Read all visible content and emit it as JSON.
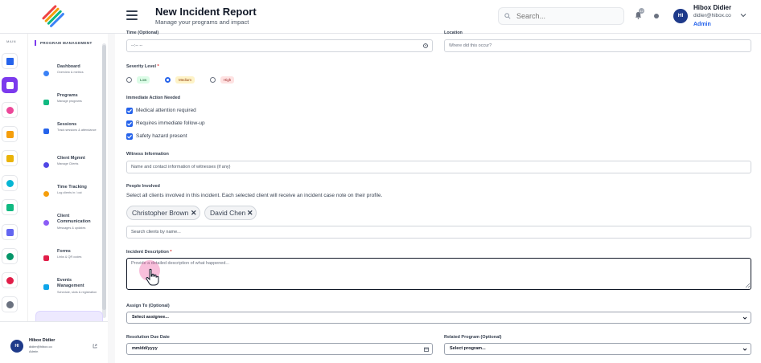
{
  "header": {
    "title": "New Incident Report",
    "subtitle": "Manage your programs and impact",
    "search_placeholder": "Search...",
    "notification_count": "12",
    "user": {
      "initials": "HI",
      "name": "Hibox Didier",
      "email": "didier@hibox.co",
      "role": "Admin"
    }
  },
  "rail": {
    "label": "MAIN"
  },
  "sidebar": {
    "section_title": "PROGRAM MANAGEMENT",
    "items": [
      {
        "label": "Dashboard",
        "desc": "Overview & metrics",
        "icon": "dashboard-icon"
      },
      {
        "label": "Programs",
        "desc": "Manage programs",
        "icon": "programs-icon"
      },
      {
        "label": "Sessions",
        "desc": "Track sessions & attendance",
        "icon": "sessions-icon"
      },
      {
        "label": "Client Mgmnt",
        "desc": "Manage Clients",
        "icon": "clients-icon"
      },
      {
        "label": "Time Tracking",
        "desc": "Log clients in / out",
        "icon": "time-icon"
      },
      {
        "label": "Client Communication",
        "desc": "Messages & updates",
        "icon": "communication-icon"
      },
      {
        "label": "Forms",
        "desc": "Links & QR codes",
        "icon": "forms-icon"
      },
      {
        "label": "Events Management",
        "desc": "Schedule, slots & registration",
        "icon": "events-icon"
      }
    ],
    "user": {
      "initials": "HI",
      "name": "Hibox Didier",
      "email": "didier@hibox.co",
      "role": "Admin"
    }
  },
  "form": {
    "time": {
      "label": "Time (Optional)",
      "value": "--:-- --"
    },
    "location": {
      "label": "Location",
      "placeholder": "Where did this occur?"
    },
    "severity": {
      "label": "Severity Level",
      "options": [
        "Low",
        "Medium",
        "High"
      ],
      "selected": "Medium"
    },
    "actions": {
      "label": "Immediate Action Needed",
      "items": [
        "Medical attention required",
        "Requires immediate follow-up",
        "Safety hazard present"
      ]
    },
    "witness": {
      "label": "Witness Information",
      "placeholder": "Name and contact information of witnesses (if any)"
    },
    "people": {
      "label": "People Involved",
      "helper": "Select all clients involved in this incident. Each selected client will receive an incident case note on their profile.",
      "chips": [
        "Christopher Brown",
        "David Chen"
      ],
      "remove_glyph": "✕",
      "search_placeholder": "Search clients by name..."
    },
    "description": {
      "label": "Incident Description",
      "placeholder": "Provide a detailed description of what happened..."
    },
    "assign": {
      "label": "Assign To (Optional)",
      "value": "Select assignee..."
    },
    "due_date": {
      "label": "Resolution Due Date",
      "value": "mm/dd/yyyy"
    },
    "program": {
      "label": "Related Program (Optional)",
      "value": "Select program..."
    },
    "required_mark": "*"
  },
  "colors": {
    "accent": "#7c3aed",
    "primary": "#2563eb",
    "low": "#dcfce7",
    "medium": "#fef3c7",
    "high": "#fee2e2"
  }
}
